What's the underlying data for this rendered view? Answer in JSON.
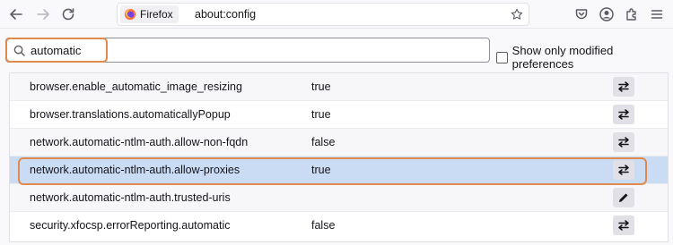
{
  "browser": {
    "identity_label": "Firefox",
    "url": "about:config"
  },
  "toolbar_icons": [
    "back-icon",
    "forward-icon",
    "reload-icon",
    "bookmark-star-icon",
    "pocket-icon",
    "account-icon",
    "extensions-icon",
    "menu-icon"
  ],
  "search": {
    "value": "automatic",
    "placeholder": ""
  },
  "filter": {
    "label": "Show only modified preferences",
    "checked": false
  },
  "prefs": [
    {
      "name": "browser.enable_automatic_image_resizing",
      "value": "true",
      "action": "toggle-icon"
    },
    {
      "name": "browser.translations.automaticallyPopup",
      "value": "true",
      "action": "toggle-icon"
    },
    {
      "name": "network.automatic-ntlm-auth.allow-non-fqdn",
      "value": "false",
      "action": "toggle-icon"
    },
    {
      "name": "network.automatic-ntlm-auth.allow-proxies",
      "value": "true",
      "action": "toggle-icon",
      "selected": true
    },
    {
      "name": "network.automatic-ntlm-auth.trusted-uris",
      "value": "",
      "action": "edit-icon"
    },
    {
      "name": "security.xfocsp.errorReporting.automatic",
      "value": "false",
      "action": "toggle-icon"
    }
  ],
  "colors": {
    "highlight": "#e08a4f",
    "selected_row": "#c9dcf4"
  }
}
